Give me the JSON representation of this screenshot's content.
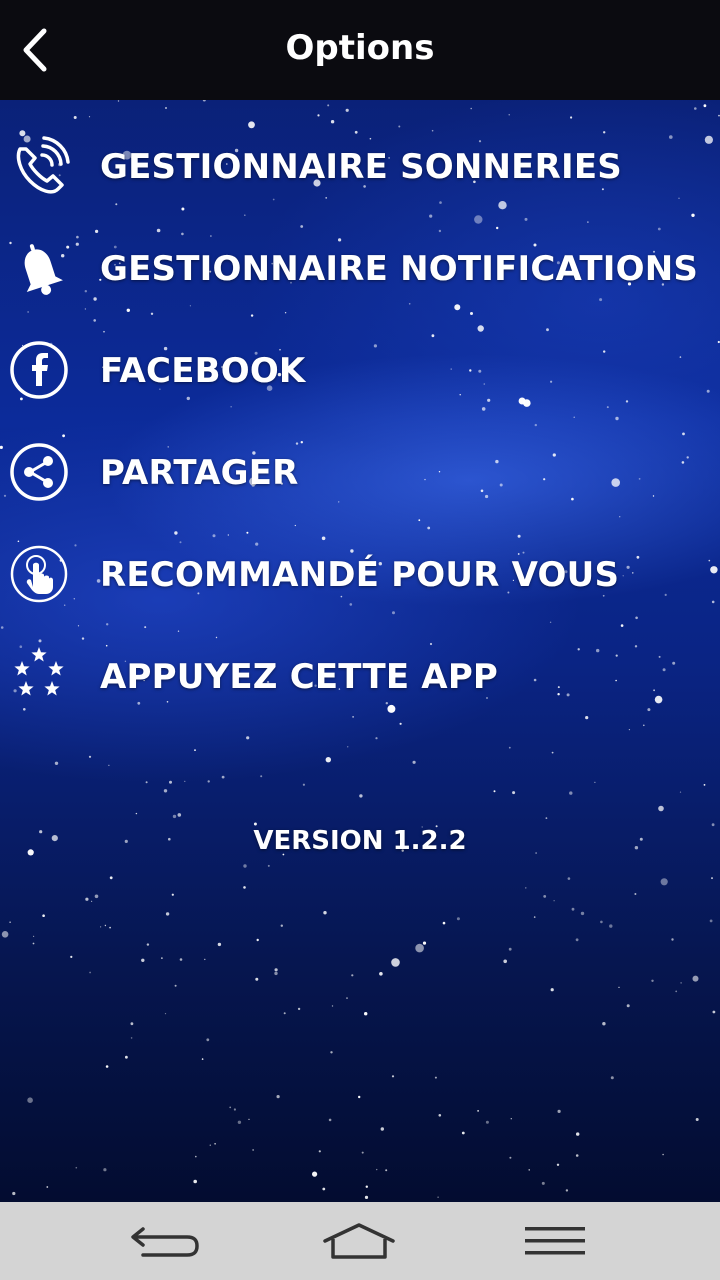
{
  "header": {
    "title": "Options"
  },
  "menu": {
    "items": [
      {
        "label": "GESTIONNAIRE SONNERIES",
        "icon": "phone-ringing-icon"
      },
      {
        "label": "GESTIONNAIRE NOTIFICATIONS",
        "icon": "bell-icon"
      },
      {
        "label": "FACEBOOK",
        "icon": "facebook-icon"
      },
      {
        "label": "PARTAGER",
        "icon": "share-icon"
      },
      {
        "label": "RECOMMANDÉ POUR VOUS",
        "icon": "touch-hand-icon"
      },
      {
        "label": "APPUYEZ CETTE APP",
        "icon": "stars-icon"
      }
    ]
  },
  "footer": {
    "version": "VERSION 1.2.2"
  },
  "navbar": {
    "buttons": [
      "back-icon",
      "home-icon",
      "menu-icon"
    ]
  },
  "colors": {
    "header_bg": "#0b0b10",
    "background": "#0c2b9a",
    "text": "#ffffff",
    "navbar_bg": "#d4d4d4"
  }
}
